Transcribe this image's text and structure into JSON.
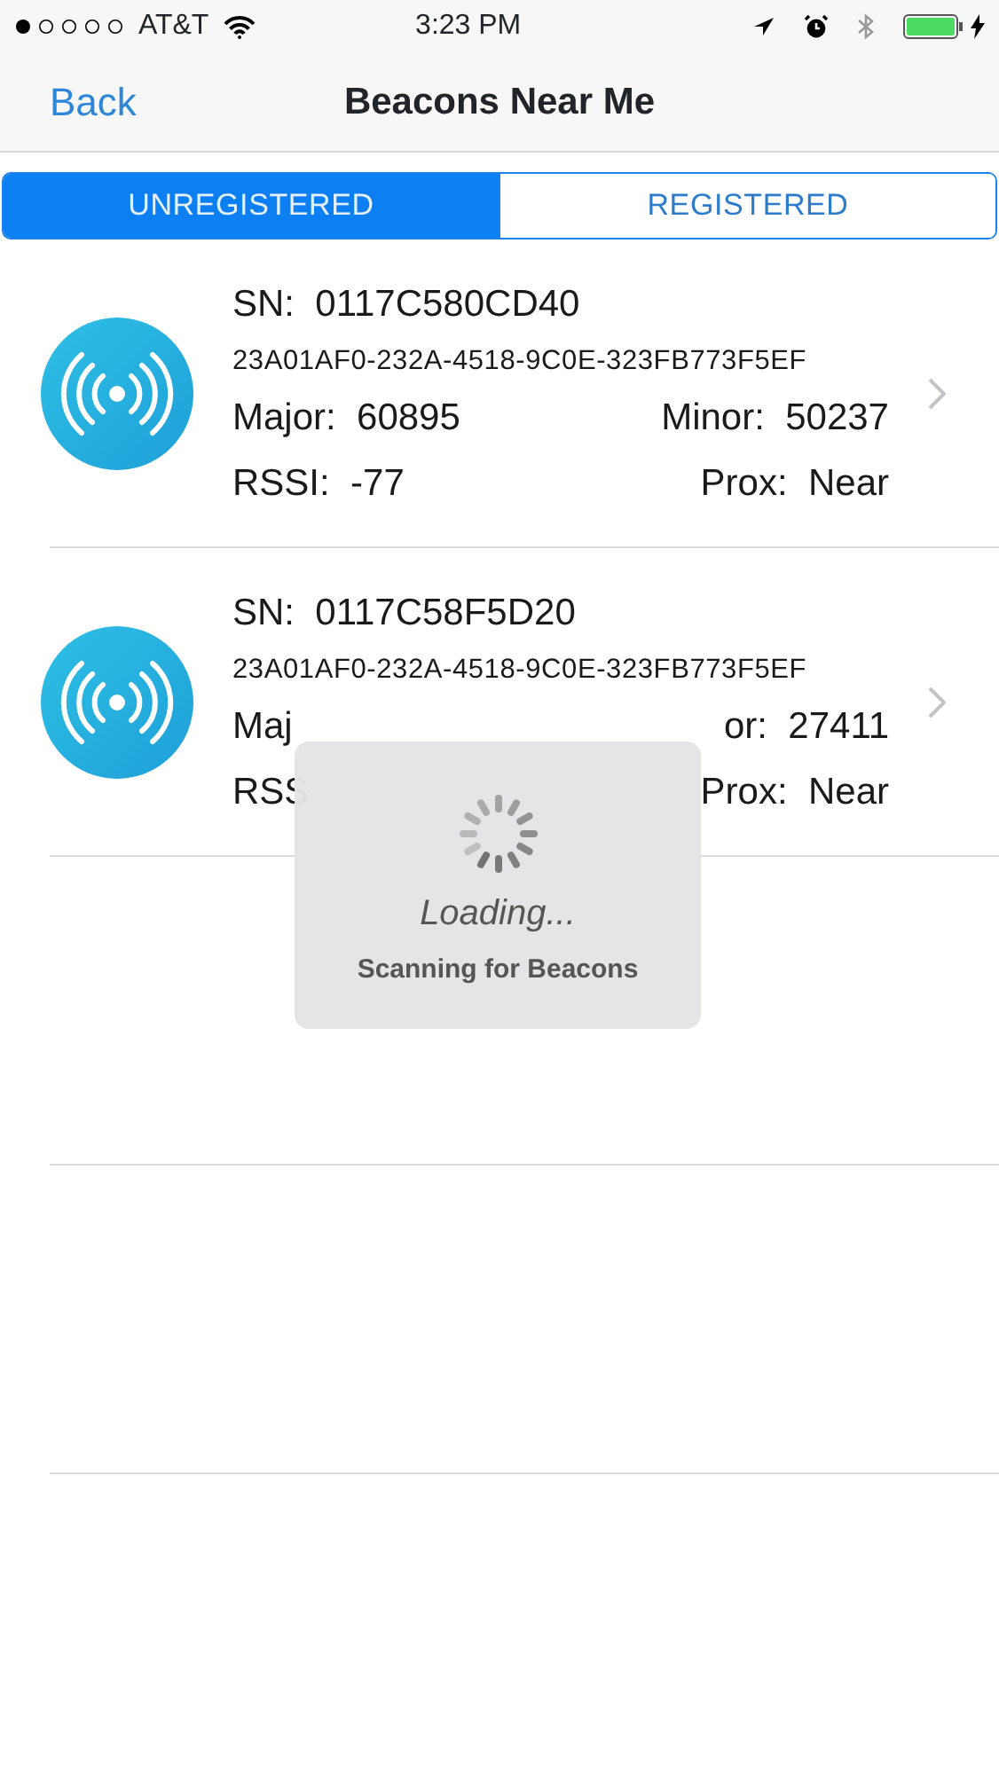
{
  "status_bar": {
    "carrier": "AT&T",
    "time": "3:23 PM"
  },
  "nav": {
    "back": "Back",
    "title": "Beacons Near Me"
  },
  "tabs": [
    {
      "label": "UNREGISTERED",
      "selected": true
    },
    {
      "label": "REGISTERED",
      "selected": false
    }
  ],
  "beacons": [
    {
      "sn_label": "SN:",
      "sn": "0117C580CD40",
      "uuid": "23A01AF0-232A-4518-9C0E-323FB773F5EF",
      "major": {
        "label": "Major:",
        "value": "60895"
      },
      "minor": {
        "label": "Minor:",
        "value": "50237"
      },
      "rssi": {
        "label": "RSSI:",
        "value": "-77"
      },
      "prox": {
        "label": "Prox:",
        "value": "Near"
      }
    },
    {
      "sn_label": "SN:",
      "sn": "0117C58F5D20",
      "uuid": "23A01AF0-232A-4518-9C0E-323FB773F5EF",
      "major": {
        "label": "Maj"
      },
      "minor": {
        "label": "or:",
        "value": "27411"
      },
      "rssi": {
        "label": "RSS"
      },
      "prox": {
        "label": "Prox:",
        "value": "Near"
      }
    }
  ],
  "loading": {
    "title": "Loading...",
    "message": "Scanning for Beacons"
  }
}
